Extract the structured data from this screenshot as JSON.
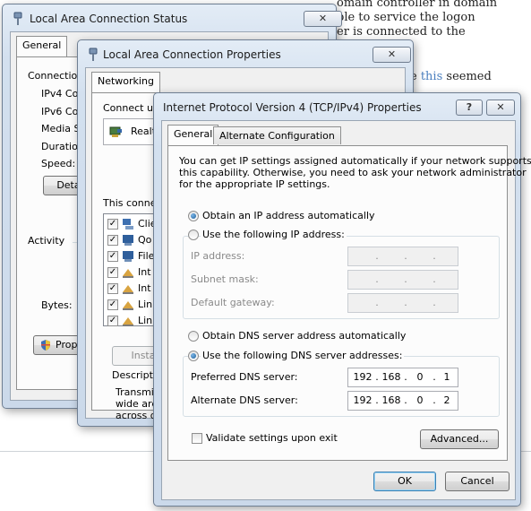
{
  "background_page": {
    "lines": [
      "omain controller in domain",
      "ble to service the logon",
      "er is connected to the"
    ],
    "line4_pre": "e ",
    "line4_link": "this",
    "line4_post": " seemed"
  },
  "status_window": {
    "title": "Local Area Connection Status",
    "close": "✕",
    "tab": "General",
    "connection_label": "Connection",
    "rows": [
      "IPv4 Co",
      "IPv6 Co",
      "Media St",
      "Duration",
      "Speed:"
    ],
    "details_button": "Detai",
    "activity_label": "Activity",
    "bytes_label": "Bytes:",
    "properties_button": "Proper"
  },
  "properties_window": {
    "title": "Local Area Connection Properties",
    "close": "✕",
    "tab": "Networking",
    "connect_using_label": "Connect usi",
    "adapter_name": "Realt",
    "this_connection_label": "This connec",
    "items": [
      "Clie",
      "Qo",
      "File",
      "Int",
      "Int",
      "Lin",
      "Lin"
    ],
    "install_button": "Insta",
    "description_label": "Descriptio",
    "description_lines": [
      "Transmis",
      "wide area",
      "across di"
    ]
  },
  "ipv4_dialog": {
    "title": "Internet Protocol Version 4 (TCP/IPv4) Properties",
    "help": "?",
    "close": "✕",
    "tabs": [
      "General",
      "Alternate Configuration"
    ],
    "intro_lines": [
      "You can get IP settings assigned automatically if your network supports",
      "this capability. Otherwise, you need to ask your network administrator",
      "for the appropriate IP settings."
    ],
    "obtain_ip_auto": "Obtain an IP address automatically",
    "use_following_ip": "Use the following IP address:",
    "ip_address_label": "IP address:",
    "subnet_mask_label": "Subnet mask:",
    "default_gateway_label": "Default gateway:",
    "obtain_dns_auto": "Obtain DNS server address automatically",
    "use_following_dns": "Use the following DNS server addresses:",
    "preferred_dns_label": "Preferred DNS server:",
    "alternate_dns_label": "Alternate DNS server:",
    "preferred_dns": [
      "192",
      "168",
      "0",
      "1"
    ],
    "alternate_dns": [
      "192",
      "168",
      "0",
      "2"
    ],
    "validate_label": "Validate settings upon exit",
    "advanced_button": "Advanced...",
    "ok_button": "OK",
    "cancel_button": "Cancel",
    "dot": "."
  },
  "colors": {
    "title_gradient_top": "#e3ecf6",
    "link": "#4b7fbf",
    "radio_dot": "#1e5d96"
  }
}
